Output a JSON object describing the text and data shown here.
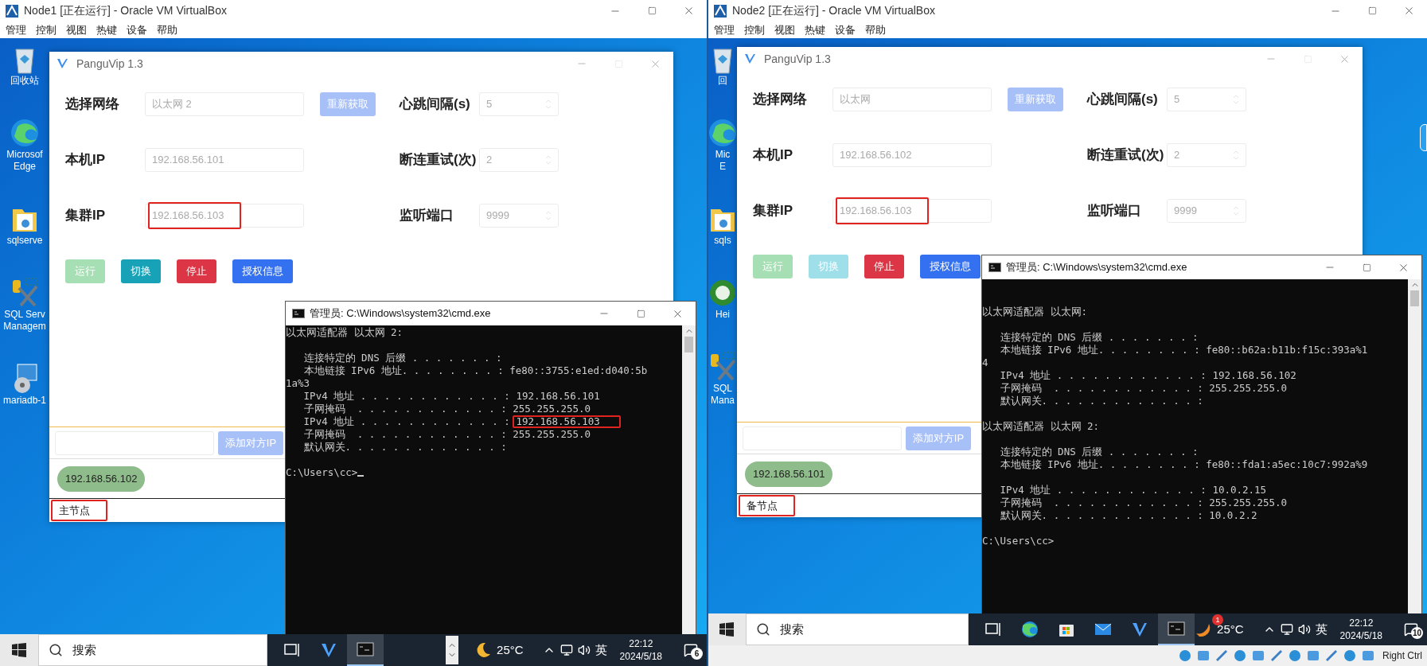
{
  "vms": [
    {
      "title": "Node1 [正在运行] - Oracle VM VirtualBox",
      "menu": [
        "管理",
        "控制",
        "视图",
        "热键",
        "设备",
        "帮助"
      ],
      "desktop_icons": [
        {
          "kind": "recycle",
          "lines": [
            "回收站"
          ]
        },
        {
          "kind": "edge",
          "lines": [
            "Microsof",
            "Edge"
          ]
        },
        {
          "kind": "folder",
          "lines": [
            "sqlserve"
          ]
        },
        {
          "kind": "sqltools",
          "lines": [
            "SQL Serv",
            "Managem"
          ]
        },
        {
          "kind": "installer",
          "lines": [
            "mariadb-1"
          ]
        }
      ],
      "app": {
        "title": "PanguVip 1.3",
        "rows": [
          {
            "label": "选择网络",
            "value": "以太网 2",
            "highlighted": false
          },
          {
            "label": "本机IP",
            "value": "192.168.56.101",
            "highlighted": false
          },
          {
            "label": "集群IP",
            "value": "192.168.56.103",
            "highlighted": true
          }
        ],
        "refresh": {
          "label": "重新获取",
          "disabled": true
        },
        "settings": [
          {
            "label": "心跳间隔(s)",
            "value": "5"
          },
          {
            "label": "断连重试(次)",
            "value": "2"
          },
          {
            "label": "监听端口",
            "value": "9999"
          }
        ],
        "buttons": [
          {
            "kind": "run",
            "label": "运行",
            "disabled": true
          },
          {
            "kind": "switch",
            "label": "切换",
            "disabled": false
          },
          {
            "kind": "stop",
            "label": "停止",
            "disabled": false
          },
          {
            "kind": "info",
            "label": "授权信息",
            "disabled": false
          }
        ],
        "add": {
          "label": "添加对方IP",
          "disabled": true
        },
        "peers": [
          {
            "ip": "192.168.56.102"
          }
        ],
        "status": {
          "text": "主节点",
          "highlighted": true
        }
      },
      "console": {
        "title": "管理员: C:\\Windows\\system32\\cmd.exe",
        "lines": [
          {
            "kind": "text",
            "text": "以太网适配器 以太网 2:",
            "highlighted": false
          },
          {
            "kind": "blank"
          },
          {
            "kind": "text",
            "text": "   连接特定的 DNS 后缀 . . . . . . . :",
            "highlighted": false
          },
          {
            "kind": "text",
            "text": "   本地链接 IPv6 地址. . . . . . . . : ",
            "value": "fe80::3755:e1ed:d040:5b",
            "highlighted": false
          },
          {
            "kind": "text",
            "text": "1a%3",
            "highlighted": false
          },
          {
            "kind": "text",
            "text": "   IPv4 地址 . . . . . . . . . . . . : ",
            "value": "192.168.56.101",
            "highlighted": false
          },
          {
            "kind": "text",
            "text": "   子网掩码  . . . . . . . . . . . . : ",
            "value": "255.255.255.0",
            "highlighted": false
          },
          {
            "kind": "text",
            "text": "   IPv4 地址 . . . . . . . . . . . . : ",
            "value": "192.168.56.103",
            "highlighted": true
          },
          {
            "kind": "text",
            "text": "   子网掩码  . . . . . . . . . . . . : ",
            "value": "255.255.255.0",
            "highlighted": false
          },
          {
            "kind": "text",
            "text": "   默认网关. . . . . . . . . . . . . :",
            "highlighted": false
          },
          {
            "kind": "blank"
          },
          {
            "kind": "prompt",
            "text": "C:\\Users\\cc>",
            "cursor": true
          }
        ]
      },
      "taskbar": {
        "search": "搜索",
        "apps": [
          {
            "kind": "taskview",
            "active": false
          },
          {
            "kind": "vip",
            "active": false
          },
          {
            "kind": "cmd",
            "active": true
          }
        ],
        "scroll_arrows": true,
        "weather": {
          "kind": "moon",
          "temp": "25°C"
        },
        "ime": "英",
        "time": "22:12",
        "date": "2024/5/18",
        "notifications": "6"
      }
    },
    {
      "title": "Node2 [正在运行] - Oracle VM VirtualBox",
      "menu": [
        "管理",
        "控制",
        "视图",
        "热键",
        "设备",
        "帮助"
      ],
      "desktop_icons": [
        {
          "kind": "recycle",
          "lines": [
            "回"
          ]
        },
        {
          "kind": "edge",
          "lines": [
            "Mic",
            "E"
          ]
        },
        {
          "kind": "folder",
          "lines": [
            "sqls"
          ]
        },
        {
          "kind": "heidi",
          "lines": [
            "Hei"
          ]
        },
        {
          "kind": "sqltools",
          "lines": [
            "SQL",
            "Mana"
          ]
        }
      ],
      "app": {
        "title": "PanguVip 1.3",
        "rows": [
          {
            "label": "选择网络",
            "value": "以太网",
            "highlighted": false
          },
          {
            "label": "本机IP",
            "value": "192.168.56.102",
            "highlighted": false
          },
          {
            "label": "集群IP",
            "value": "192.168.56.103",
            "highlighted": true
          }
        ],
        "refresh": {
          "label": "重新获取",
          "disabled": true
        },
        "settings": [
          {
            "label": "心跳间隔(s)",
            "value": "5"
          },
          {
            "label": "断连重试(次)",
            "value": "2"
          },
          {
            "label": "监听端口",
            "value": "9999"
          }
        ],
        "buttons": [
          {
            "kind": "run",
            "label": "运行",
            "disabled": true
          },
          {
            "kind": "switch",
            "label": "切换",
            "disabled": true
          },
          {
            "kind": "stop",
            "label": "停止",
            "disabled": false
          },
          {
            "kind": "info",
            "label": "授权信息",
            "disabled": false
          }
        ],
        "add": {
          "label": "添加对方IP",
          "disabled": true
        },
        "peers": [
          {
            "ip": "192.168.56.101"
          }
        ],
        "status": {
          "text": "备节点",
          "highlighted": true
        }
      },
      "console": {
        "title": "管理员: C:\\Windows\\system32\\cmd.exe",
        "lines": [
          {
            "kind": "blank"
          },
          {
            "kind": "blank"
          },
          {
            "kind": "text",
            "text": "以太网适配器 以太网:",
            "highlighted": false
          },
          {
            "kind": "blank"
          },
          {
            "kind": "text",
            "text": "   连接特定的 DNS 后缀 . . . . . . . :",
            "highlighted": false
          },
          {
            "kind": "text",
            "text": "   本地链接 IPv6 地址. . . . . . . . : ",
            "value": "fe80::b62a:b11b:f15c:393a%1",
            "highlighted": false
          },
          {
            "kind": "text",
            "text": "4",
            "highlighted": false
          },
          {
            "kind": "text",
            "text": "   IPv4 地址 . . . . . . . . . . . . : ",
            "value": "192.168.56.102",
            "highlighted": false
          },
          {
            "kind": "text",
            "text": "   子网掩码  . . . . . . . . . . . . : ",
            "value": "255.255.255.0",
            "highlighted": false
          },
          {
            "kind": "text",
            "text": "   默认网关. . . . . . . . . . . . . :",
            "highlighted": false
          },
          {
            "kind": "blank"
          },
          {
            "kind": "text",
            "text": "以太网适配器 以太网 2:",
            "highlighted": false
          },
          {
            "kind": "blank"
          },
          {
            "kind": "text",
            "text": "   连接特定的 DNS 后缀 . . . . . . . :",
            "highlighted": false
          },
          {
            "kind": "text",
            "text": "   本地链接 IPv6 地址. . . . . . . . : ",
            "value": "fe80::fda1:a5ec:10c7:992a%9",
            "highlighted": false
          },
          {
            "kind": "blank"
          },
          {
            "kind": "text",
            "text": "   IPv4 地址 . . . . . . . . . . . . : ",
            "value": "10.0.2.15",
            "highlighted": false
          },
          {
            "kind": "text",
            "text": "   子网掩码  . . . . . . . . . . . . : ",
            "value": "255.255.255.0",
            "highlighted": false
          },
          {
            "kind": "text",
            "text": "   默认网关. . . . . . . . . . . . . : ",
            "value": "10.0.2.2",
            "highlighted": false
          },
          {
            "kind": "blank"
          },
          {
            "kind": "prompt",
            "text": "C:\\Users\\cc>",
            "cursor": false
          }
        ]
      },
      "taskbar": {
        "search": "搜索",
        "apps": [
          {
            "kind": "taskview",
            "active": false
          },
          {
            "kind": "edge",
            "active": false
          },
          {
            "kind": "store",
            "active": false
          },
          {
            "kind": "mail",
            "active": false
          },
          {
            "kind": "vip",
            "active": false
          },
          {
            "kind": "cmd",
            "active": true
          }
        ],
        "scroll_arrows": false,
        "weather": {
          "kind": "sun",
          "temp": "25°C",
          "badge": "1"
        },
        "ime": "英",
        "time": "22:12",
        "date": "2024/5/18",
        "notifications": "10"
      },
      "status_bar": {
        "host_key": "Right Ctrl"
      }
    }
  ]
}
